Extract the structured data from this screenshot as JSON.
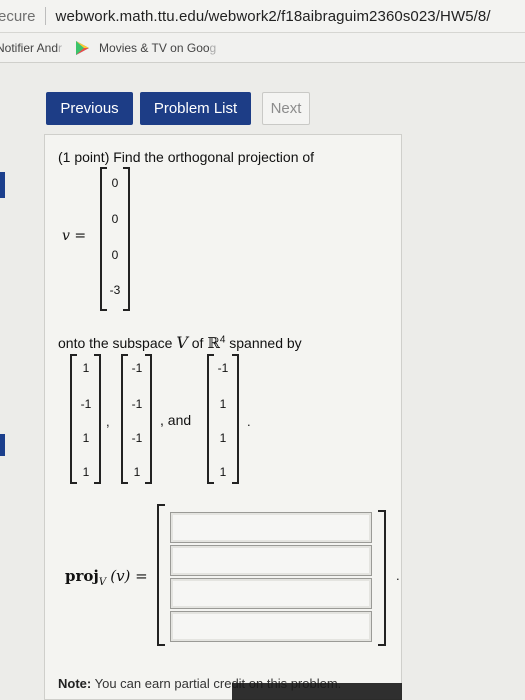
{
  "browser": {
    "secure_label": "ecure",
    "url": "webwork.math.ttu.edu/webwork2/f18aibraguim2360s023/HW5/8/",
    "bookmarks": [
      {
        "label": "Notifier And",
        "fade": "r"
      },
      {
        "label": "Movies & TV on Goo",
        "fade": "g"
      }
    ]
  },
  "nav": {
    "previous": "Previous",
    "problem_list": "Problem List",
    "next": "Next"
  },
  "problem": {
    "intro": "(1 point) Find the orthogonal projection of",
    "v_label": "v =",
    "v_values": [
      "0",
      "0",
      "0",
      "-3"
    ],
    "onto_text_1": "onto the subspace",
    "V_symbol": "V",
    "onto_text_2": "of",
    "R4": "ℝ",
    "R4_exp": "4",
    "onto_text_3": "spanned by",
    "basis_1": [
      "1",
      "-1",
      "1",
      "1"
    ],
    "basis_2": [
      "-1",
      "-1",
      "-1",
      "1"
    ],
    "basis_3": [
      "-1",
      "1",
      "1",
      "1"
    ],
    "comma": ",",
    "and_text": ", and",
    "period": ".",
    "proj_label": "proj",
    "proj_sub": "V",
    "proj_arg": "(v) =",
    "answer_values": [
      "",
      "",
      "",
      ""
    ]
  },
  "note": {
    "label": "Note:",
    "text": "You can earn partial credit on this problem."
  }
}
